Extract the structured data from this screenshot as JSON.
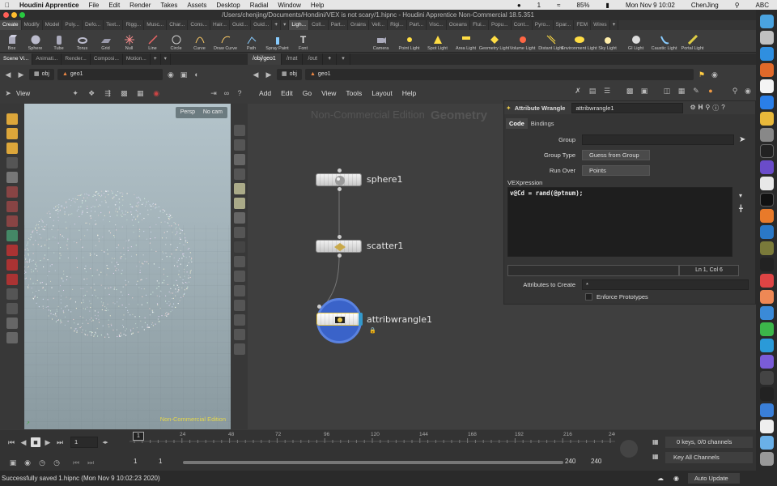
{
  "menubar": {
    "app": "Houdini Apprentice",
    "items": [
      "File",
      "Edit",
      "Render",
      "Takes",
      "Assets",
      "Desktop",
      "Radial",
      "Window",
      "Help"
    ],
    "battery": "85%",
    "datetime": "Mon Nov 9  10:02",
    "user": "ChenJing",
    "notif": "1",
    "ime": "ABC"
  },
  "titlebar": {
    "text": "/Users/chenjing/Documents/Hondini/VEX is not scary/1.hipnc - Houdini Apprentice Non-Commercial 18.5.351"
  },
  "shelf": {
    "tabs": [
      "Create",
      "Modify",
      "Model",
      "Poly...",
      "Defo...",
      "Text...",
      "Rigg...",
      "Musc...",
      "Char...",
      "Cons...",
      "Hair...",
      "Guid...",
      "Guid..."
    ],
    "right_tabs": [
      "Ligh...",
      "Coll...",
      "Part...",
      "Grains",
      "Vell...",
      "Rigi...",
      "Part...",
      "Visc...",
      "Oceans",
      "Flui...",
      "Popu...",
      "Cont...",
      "Pyro...",
      "Spar...",
      "FEM",
      "Wires"
    ],
    "tools": [
      "Box",
      "Sphere",
      "Tube",
      "Torus",
      "Grid",
      "Null",
      "Line",
      "Circle",
      "Curve",
      "Draw Curve",
      "Path",
      "Spray Paint",
      "Font"
    ],
    "right_tools": [
      "Camera",
      "Point Light",
      "Spot Light",
      "Area Light",
      "Geometry Light",
      "Volume Light",
      "Distant Light",
      "Environment Light",
      "Sky Light",
      "GI Light",
      "Caustic Light",
      "Portal Light"
    ]
  },
  "left_pane": {
    "tabs": [
      "Scene Vi...",
      "Animati...",
      "Render...",
      "Composi...",
      "Motion..."
    ],
    "path": "obj",
    "path2": "geo1",
    "view_label": "View",
    "persp": "Persp",
    "cam": "No cam",
    "watermark": "Non-Commercial Edition"
  },
  "network": {
    "tabs": [
      "/obj/geo1",
      "/mat",
      "/out"
    ],
    "path": "obj",
    "path2": "geo1",
    "menu": [
      "Add",
      "Edit",
      "Go",
      "View",
      "Tools",
      "Layout",
      "Help"
    ],
    "wm1": "Non-Commercial Edition",
    "wm2": "Geometry",
    "nodes": [
      "sphere1",
      "scatter1",
      "attribwrangle1"
    ]
  },
  "params": {
    "node_type": "Attribute Wrangle",
    "node_name": "attribwrangle1",
    "tabs": [
      "Code",
      "Bindings"
    ],
    "group_label": "Group",
    "group_type_label": "Group Type",
    "group_type_value": "Guess from Group",
    "run_over_label": "Run Over",
    "run_over_value": "Points",
    "vex_label": "VEXpression",
    "vex_code": "v@Cd  = rand(@ptnum);",
    "cursor_pos": "Ln 1, Col 6",
    "attr_create_label": "Attributes to Create",
    "attr_create_value": "*",
    "enforce_label": "Enforce Prototypes"
  },
  "timeline": {
    "frame": "1",
    "ticks": [
      "1",
      "24",
      "48",
      "72",
      "96",
      "120",
      "144",
      "168",
      "192",
      "216",
      "240"
    ],
    "start": "1",
    "start2": "1",
    "end": "240",
    "end2": "240",
    "keys": "0 keys, 0/0 channels",
    "key_all": "Key All Channels",
    "auto_update": "Auto Update"
  },
  "status": {
    "text": "Successfully saved 1.hipnc (Mon Nov  9 10:02:23 2020)"
  }
}
